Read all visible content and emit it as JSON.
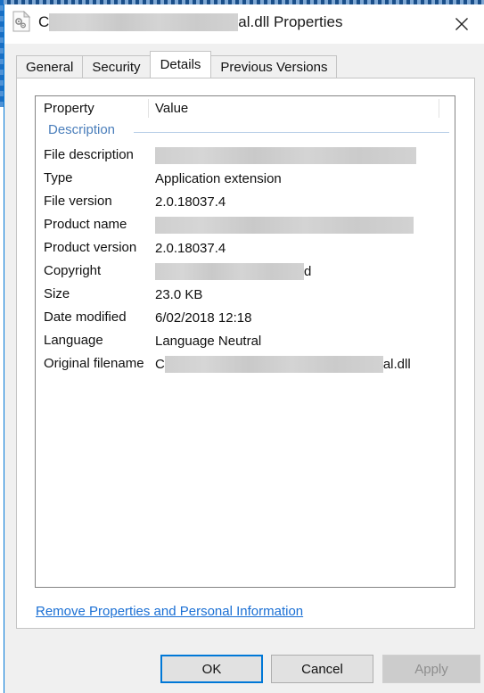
{
  "window": {
    "title_prefix": "C",
    "title_redacted_width": 212,
    "title_suffix": "al.dll Properties",
    "icon": "dll-file-icon",
    "close_icon": "close-icon"
  },
  "tabs": [
    {
      "label": "General",
      "selected": false
    },
    {
      "label": "Security",
      "selected": false
    },
    {
      "label": "Details",
      "selected": true
    },
    {
      "label": "Previous Versions",
      "selected": false
    }
  ],
  "list": {
    "headers": {
      "property": "Property",
      "value": "Value"
    },
    "section": {
      "label": "Description"
    },
    "rows": [
      {
        "name": "File description",
        "value": "",
        "redacted": true,
        "redact_width": 293,
        "prefix": "",
        "suffix": ""
      },
      {
        "name": "Type",
        "value": "Application extension",
        "redacted": false
      },
      {
        "name": "File version",
        "value": "2.0.18037.4",
        "redacted": false
      },
      {
        "name": "Product name",
        "value": "",
        "redacted": true,
        "redact_width": 290,
        "prefix": "",
        "suffix": ""
      },
      {
        "name": "Product version",
        "value": "2.0.18037.4",
        "redacted": false
      },
      {
        "name": "Copyright",
        "value": "",
        "redacted": true,
        "redact_width": 167,
        "prefix": "",
        "suffix": "d"
      },
      {
        "name": "Size",
        "value": "23.0 KB",
        "redacted": false
      },
      {
        "name": "Date modified",
        "value": "6/02/2018 12:18",
        "redacted": false
      },
      {
        "name": "Language",
        "value": "Language Neutral",
        "redacted": false
      },
      {
        "name": "Original filename",
        "value": "",
        "redacted": true,
        "redact_width": 245,
        "prefix": "C",
        "suffix": "al.dll"
      }
    ]
  },
  "links": {
    "remove_properties": "Remove Properties and Personal Information"
  },
  "buttons": {
    "ok": "OK",
    "cancel": "Cancel",
    "apply": "Apply"
  },
  "colors": {
    "accent": "#0078d7",
    "link": "#1a6fd4",
    "section_header": "#4a7ebb",
    "dialog_bg": "#f0f0f0",
    "panel_bg": "#ffffff",
    "button_face": "#e1e1e1",
    "disabled_text": "#8e8e8e",
    "redaction": "#cfcfcf"
  }
}
